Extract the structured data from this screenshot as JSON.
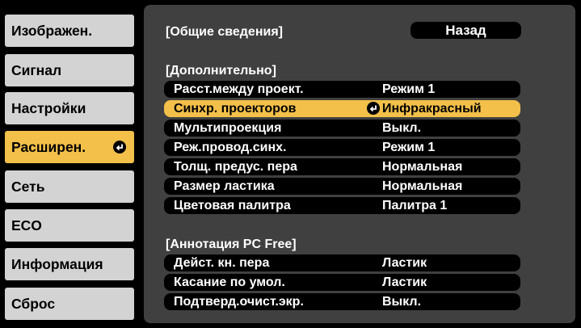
{
  "sidebar": {
    "items": [
      {
        "label": "Изображен."
      },
      {
        "label": "Сигнал"
      },
      {
        "label": "Настройки"
      },
      {
        "label": "Расширен."
      },
      {
        "label": "Сеть"
      },
      {
        "label": "ECO"
      },
      {
        "label": "Информация"
      },
      {
        "label": "Сброс"
      }
    ],
    "active_index": 3
  },
  "panel": {
    "heading": "[Общие сведения]",
    "back_label": "Назад",
    "section_advanced": "[Дополнительно]",
    "advanced_rows": [
      {
        "label": "Расст.между проект.",
        "value": "Режим 1"
      },
      {
        "label": "Синхр. проекторов",
        "value": "Инфракрасный"
      },
      {
        "label": "Мультипроекция",
        "value": "Выкл."
      },
      {
        "label": "Реж.провод.синх.",
        "value": "Режим 1"
      },
      {
        "label": "Толщ. предус. пера",
        "value": "Нормальная"
      },
      {
        "label": "Размер ластика",
        "value": "Нормальная"
      },
      {
        "label": "Цветовая палитра",
        "value": "Палитра 1"
      }
    ],
    "section_annotation": "[Аннотация PC Free]",
    "annotation_rows": [
      {
        "label": "Дейст. кн. пера",
        "value": "Ластик"
      },
      {
        "label": "Касание по умол.",
        "value": "Ластик"
      },
      {
        "label": "Подтверд.очист.экр.",
        "value": "Выкл."
      }
    ]
  },
  "colors": {
    "highlight": "#f3c04a",
    "panel_bg": "#404040",
    "tab_bg": "#d3d3d3"
  }
}
